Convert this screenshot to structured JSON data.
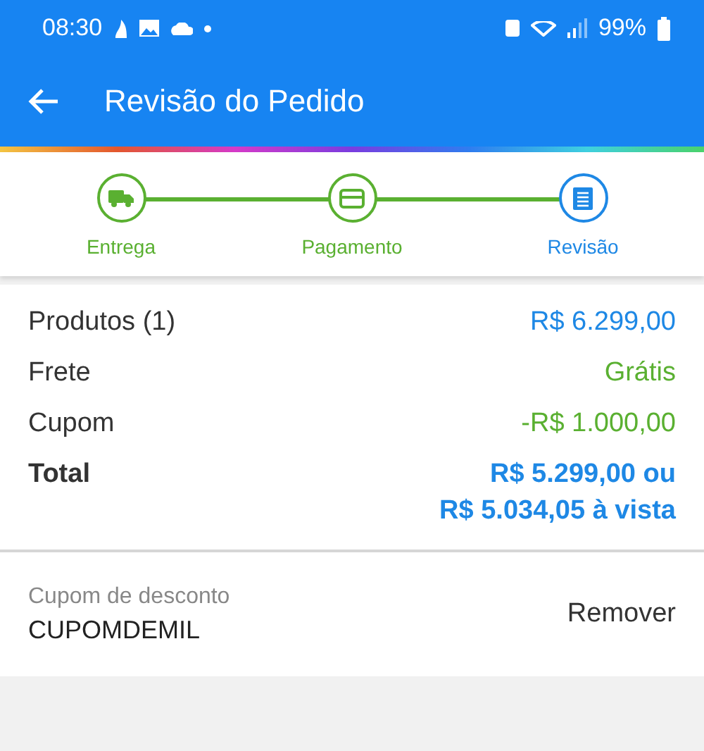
{
  "status_bar": {
    "time": "08:30",
    "battery": "99%"
  },
  "app_bar": {
    "title": "Revisão do Pedido"
  },
  "steps": [
    {
      "label": "Entrega",
      "kind": "truck",
      "selected": false
    },
    {
      "label": "Pagamento",
      "kind": "card",
      "selected": false
    },
    {
      "label": "Revisão",
      "kind": "list",
      "selected": true
    }
  ],
  "summary": [
    {
      "label": "Produtos (1)",
      "value": [
        "R$ 6.299,00"
      ],
      "color": "#1e88e5",
      "kind": "normal"
    },
    {
      "label": "Frete",
      "value": [
        "Grátis"
      ],
      "color": "#5ab031",
      "kind": "normal"
    },
    {
      "label": "Cupom",
      "value": [
        "-R$ 1.000,00"
      ],
      "color": "#5ab031",
      "kind": "normal"
    },
    {
      "label": "Total",
      "value": [
        "R$ 5.299,00 ou",
        "R$ 5.034,05 à vista"
      ],
      "color": "#1e88e5",
      "kind": "total"
    }
  ],
  "coupon": {
    "label": "Cupom de desconto",
    "code": "CUPOMDEMIL",
    "action": "Remover"
  }
}
